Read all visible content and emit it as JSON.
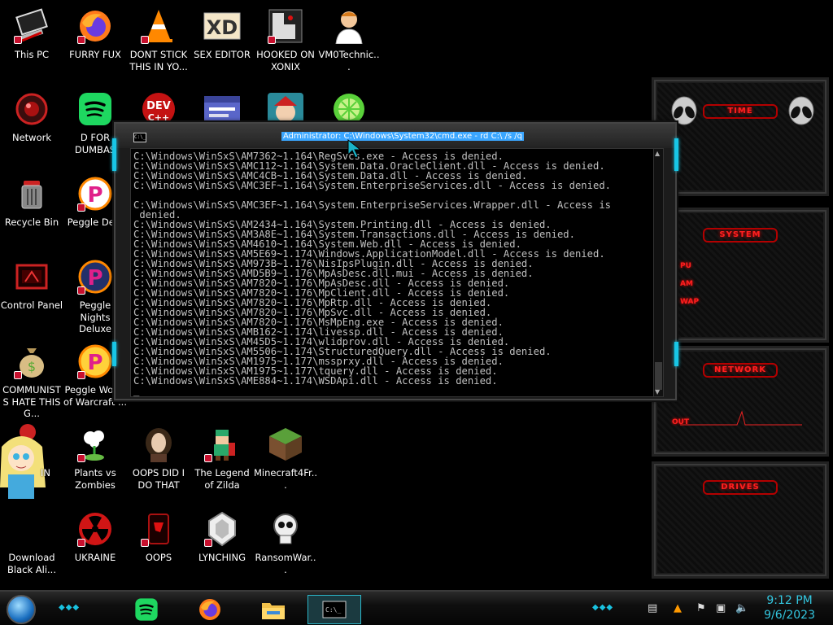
{
  "desktop": {
    "icons": [
      {
        "label": "This PC",
        "icon": "computer-icon"
      },
      {
        "label": "FURRY FUX",
        "icon": "firefox-icon"
      },
      {
        "label": "DONT STICK THIS IN YO...",
        "icon": "vlc-icon"
      },
      {
        "label": "SEX EDITOR",
        "icon": "hex-editor-icon"
      },
      {
        "label": "HOOKED ON XONIX",
        "icon": "xonix-icon"
      },
      {
        "label": "VM0Technic...",
        "icon": "doctor-icon"
      },
      {
        "label": "Network",
        "icon": "network-icon"
      },
      {
        "label": "D FOR DUMBAS",
        "icon": "spotify-icon"
      },
      {
        "label": "Recycle Bin",
        "icon": "recycle-bin-icon"
      },
      {
        "label": "Peggle Delu",
        "icon": "peggle-icon"
      },
      {
        "label": "Control Panel",
        "icon": "control-panel-icon"
      },
      {
        "label": "Peggle Nights Deluxe",
        "icon": "peggle-icon"
      },
      {
        "label": "COMMUNISTS HATE THIS G...",
        "icon": "money-bag-icon"
      },
      {
        "label": "Peggle World of Warcraft ...",
        "icon": "peggle-icon"
      },
      {
        "label": "IN",
        "icon": "cartoon-girl-icon"
      },
      {
        "label": "Plants vs Zombies",
        "icon": "plant-icon"
      },
      {
        "label": "OOPS DID I DO THAT",
        "icon": "portrait-icon"
      },
      {
        "label": "The Legend of Zilda",
        "icon": "pixel-hero-icon"
      },
      {
        "label": "Minecraft4Fr...",
        "icon": "minecraft-icon"
      },
      {
        "label": "Download Black Ali...",
        "icon": "download-icon"
      },
      {
        "label": "UKRAINE",
        "icon": "radiation-icon"
      },
      {
        "label": "OOPS",
        "icon": "red-device-icon"
      },
      {
        "label": "LYNCHING",
        "icon": "shield-icon"
      },
      {
        "label": "RansomWar...",
        "icon": "skull-icon"
      }
    ],
    "unlabeled_icons": [
      "dev-cpp-icon",
      "window-icon",
      "santa-icon",
      "lime-icon"
    ]
  },
  "console": {
    "title": "Administrator: C:\\Windows\\System32\\cmd.exe - rd  C:\\ /s /q",
    "icon_text": "C:\\_",
    "lines": [
      "C:\\Windows\\WinSxS\\AM7362~1.164\\RegSvcs.exe - Access is denied.",
      "C:\\Windows\\WinSxS\\AMC112~1.164\\System.Data.OracleClient.dll - Access is denied.",
      "C:\\Windows\\WinSxS\\AMC4CB~1.164\\System.Data.dll - Access is denied.",
      "C:\\Windows\\WinSxS\\AMC3EF~1.164\\System.EnterpriseServices.dll - Access is denied.",
      "",
      "C:\\Windows\\WinSxS\\AMC3EF~1.164\\System.EnterpriseServices.Wrapper.dll - Access is",
      " denied.",
      "C:\\Windows\\WinSxS\\AM2434~1.164\\System.Printing.dll - Access is denied.",
      "C:\\Windows\\WinSxS\\AM3A8E~1.164\\System.Transactions.dll - Access is denied.",
      "C:\\Windows\\WinSxS\\AM4610~1.164\\System.Web.dll - Access is denied.",
      "C:\\Windows\\WinSxS\\AM5E69~1.174\\Windows.ApplicationModel.dll - Access is denied.",
      "C:\\Windows\\WinSxS\\AM973B~1.176\\NisIpsPlugin.dll - Access is denied.",
      "C:\\Windows\\WinSxS\\AMD5B9~1.176\\MpAsDesc.dll.mui - Access is denied.",
      "C:\\Windows\\WinSxS\\AM7820~1.176\\MpAsDesc.dll - Access is denied.",
      "C:\\Windows\\WinSxS\\AM7820~1.176\\MpClient.dll - Access is denied.",
      "C:\\Windows\\WinSxS\\AM7820~1.176\\MpRtp.dll - Access is denied.",
      "C:\\Windows\\WinSxS\\AM7820~1.176\\MpSvc.dll - Access is denied.",
      "C:\\Windows\\WinSxS\\AM7820~1.176\\MsMpEng.exe - Access is denied.",
      "C:\\Windows\\WinSxS\\AMB162~1.174\\livessp.dll - Access is denied.",
      "C:\\Windows\\WinSxS\\AM45D5~1.174\\wlidprov.dll - Access is denied.",
      "C:\\Windows\\WinSxS\\AM5506~1.174\\StructuredQuery.dll - Access is denied.",
      "C:\\Windows\\WinSxS\\AM1975~1.177\\mssprxy.dll - Access is denied.",
      "C:\\Windows\\WinSxS\\AM1975~1.177\\tquery.dll - Access is denied.",
      "C:\\Windows\\WinSxS\\AME884~1.174\\WSDApi.dll - Access is denied.",
      "_"
    ]
  },
  "gadget": {
    "time_title": "TIME",
    "system_title": "SYSTEM",
    "system_labels": [
      "PU",
      "AM",
      "WAP"
    ],
    "network_title": "NETWORK",
    "network_out_label": "OUT",
    "drives_title": "DRIVES"
  },
  "taskbar": {
    "time": "9:12 PM",
    "date": "9/6/2023",
    "pinned": [
      "spotify-icon",
      "firefox-icon",
      "file-explorer-icon",
      "console-icon"
    ],
    "active": "console-icon"
  },
  "colors": {
    "console_text": "#c0c0c0",
    "accent_cyan": "#18c6e6",
    "gadget_red": "#ff2020"
  }
}
